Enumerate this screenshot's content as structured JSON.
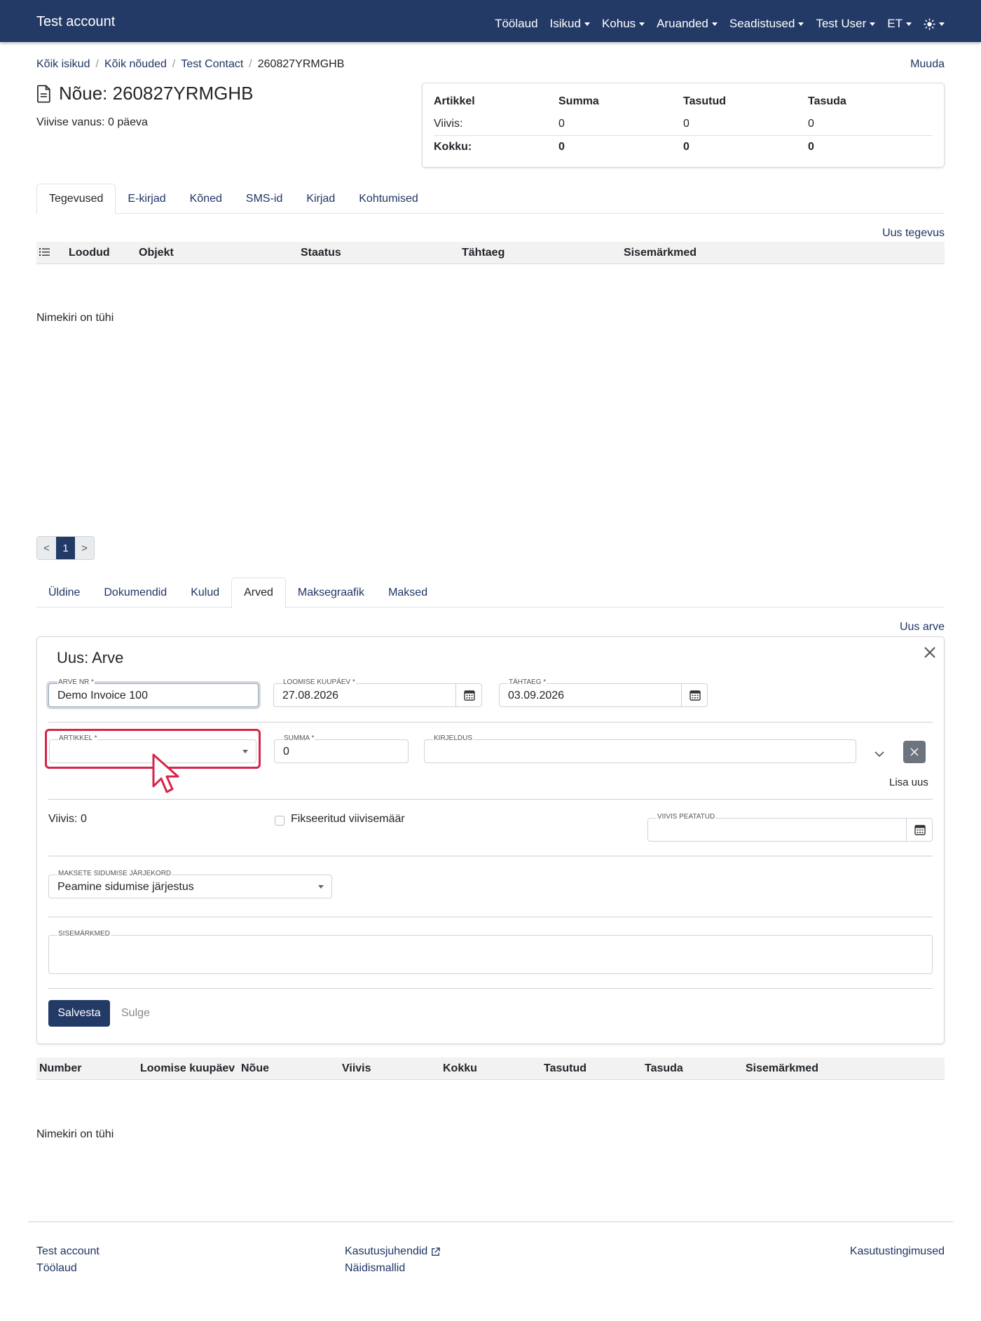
{
  "navbar": {
    "brand": "Test account",
    "items": [
      "Töölaud",
      "Isikud",
      "Kohus",
      "Aruanded",
      "Seadistused",
      "Test User",
      "ET"
    ],
    "theme_icon": "sun-icon"
  },
  "breadcrumb": {
    "items": [
      "Kõik isikud",
      "Kõik nõuded",
      "Test Contact"
    ],
    "current": "260827YRMGHB",
    "edit": "Muuda"
  },
  "claim": {
    "title": "Nõue: 260827YRMGHB",
    "age": "Viivise vanus: 0 päeva"
  },
  "summary": {
    "headers": [
      "Artikkel",
      "Summa",
      "Tasutud",
      "Tasuda"
    ],
    "row": [
      "Viivis:",
      "0",
      "0",
      "0"
    ],
    "total": [
      "Kokku:",
      "0",
      "0",
      "0"
    ]
  },
  "activity_tabs": [
    "Tegevused",
    "E-kirjad",
    "Kõned",
    "SMS-id",
    "Kirjad",
    "Kohtumised"
  ],
  "activities": {
    "new_link": "Uus tegevus",
    "headers": [
      "Loodud",
      "Objekt",
      "Staatus",
      "Tähtaeg",
      "Sisemärkmed"
    ],
    "empty": "Nimekiri on tühi"
  },
  "pager": {
    "prev": "<",
    "page": "1",
    "next": ">"
  },
  "claim_tabs": [
    "Üldine",
    "Dokumendid",
    "Kulud",
    "Arved",
    "Maksegraafik",
    "Maksed"
  ],
  "invoices": {
    "new_link": "Uus arve",
    "headers": [
      "Number",
      "Loomise kuupäev",
      "Nõue",
      "Viivis",
      "Kokku",
      "Tasutud",
      "Tasuda",
      "Sisemärkmed"
    ],
    "empty": "Nimekiri on tühi"
  },
  "form": {
    "title": "Uus: Arve",
    "invoice_no_label": "Arve nr *",
    "invoice_no_value": "Demo Invoice 100",
    "created_label": "Loomise kuupäev *",
    "created_value": "27.08.2026",
    "due_label": "Tähtaeg *",
    "due_value": "03.09.2026",
    "article_label": "Artikkel *",
    "article_value": "",
    "sum_label": "Summa *",
    "sum_value": "0",
    "desc_label": "Kirjeldus",
    "add_new": "Lisa uus",
    "interest_text": "Viivis: 0",
    "fixed_rate_label": "Fikseeritud viivisemäär",
    "interest_stopped_label": "Viivis peatatud",
    "order_label": "Maksete sidumise järjekord",
    "order_value": "Peamine sidumise järjestus",
    "notes_label": "Sisemärkmed",
    "save": "Salvesta",
    "close": "Sulge"
  },
  "footer": {
    "col1": [
      "Test account",
      "Töölaud"
    ],
    "col2": [
      "Kasutusjuhendid",
      "Näidismallid"
    ],
    "col3": [
      "Kasutustingimused"
    ]
  }
}
